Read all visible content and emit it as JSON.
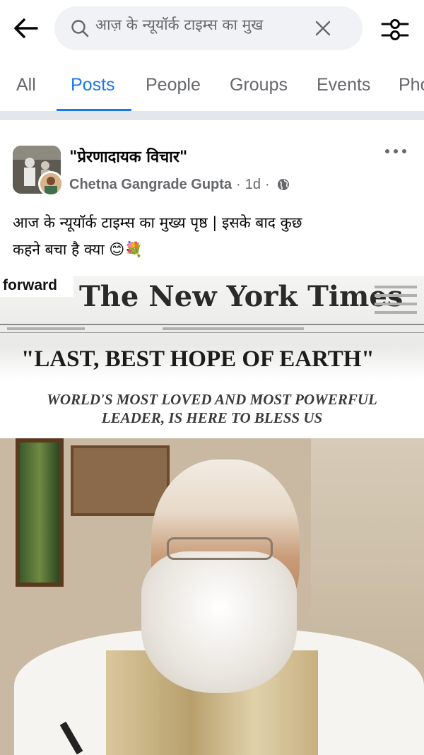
{
  "search": {
    "query": "आज़ के न्यूयॉर्क टाइम्स का मुख"
  },
  "tabs": [
    {
      "label": "All",
      "active": false
    },
    {
      "label": "Posts",
      "active": true
    },
    {
      "label": "People",
      "active": false
    },
    {
      "label": "Groups",
      "active": false
    },
    {
      "label": "Events",
      "active": false
    },
    {
      "label": "Pho",
      "active": false
    }
  ],
  "post": {
    "group_name": "\"प्रेरणादायक विचार\"",
    "author": "Chetna Gangrade Gupta",
    "time": "1d",
    "text_line1": "आज के न्यूयॉर्क टाइम्स का मुख्य पृष्ठ | इसके बाद कुछ",
    "text_line2": "कहने बचा है क्या 😊💐",
    "image": {
      "forward_label": "forward",
      "masthead": "The New York Times",
      "headline": "\"LAST, BEST HOPE OF EARTH\"",
      "subheadline_1": "WORLD'S MOST LOVED AND MOST POWERFUL",
      "subheadline_2": "LEADER, IS HERE TO BLESS US"
    }
  },
  "colors": {
    "accent": "#1877f2",
    "secondary_text": "#65676b",
    "divider": "#e4e6eb",
    "search_bg": "#f0f2f5"
  },
  "icons": {
    "back": "arrow-left-icon",
    "search": "search-icon",
    "clear": "close-icon",
    "filter": "filter-sliders-icon",
    "more": "more-horizontal-icon",
    "privacy": "globe-icon"
  }
}
